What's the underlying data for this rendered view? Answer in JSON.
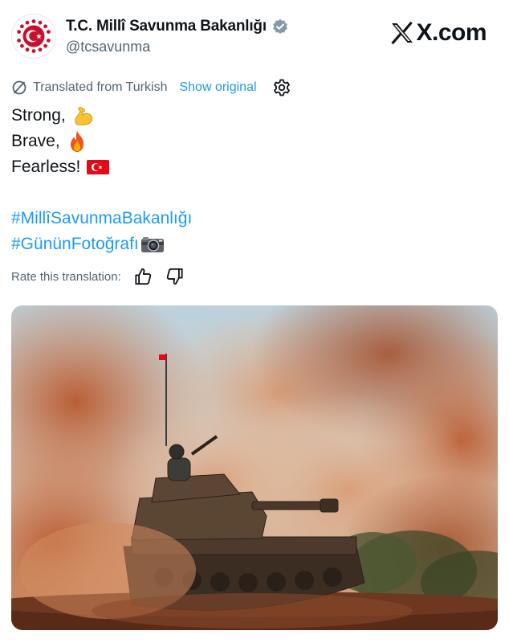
{
  "account": {
    "display_name": "T.C. Millî Savunma Bakanlığı",
    "handle": "@tcsavunma",
    "verified_badge_color": "#829aab",
    "avatar_icon": "ministry-emblem-icon"
  },
  "brand": {
    "label": "X.com",
    "logo_icon": "x-logo-icon"
  },
  "translation": {
    "notice": "Translated from Turkish",
    "show_original": "Show original",
    "settings_icon": "gear-icon"
  },
  "tweet": {
    "lines": [
      {
        "text": "Strong,",
        "emoji": "flexed-biceps-emoji"
      },
      {
        "text": "Brave,",
        "emoji": "fire-emoji"
      },
      {
        "text": "Fearless!",
        "emoji": "turkey-flag-emoji"
      }
    ],
    "hashtags": [
      {
        "text": "#MillîSavunmaBakanlığı"
      },
      {
        "text": "#GününFotoğrafı",
        "emoji": "camera-emoji"
      }
    ]
  },
  "rating": {
    "prompt": "Rate this translation:",
    "icons": [
      "thumbs-up-icon",
      "thumbs-down-icon"
    ]
  },
  "media": {
    "subject": "tank-photo"
  },
  "colors": {
    "link": "#1d9bf0",
    "secondary_text": "#536471",
    "primary_text": "#0f1419",
    "flag_red": "#e30a17"
  }
}
